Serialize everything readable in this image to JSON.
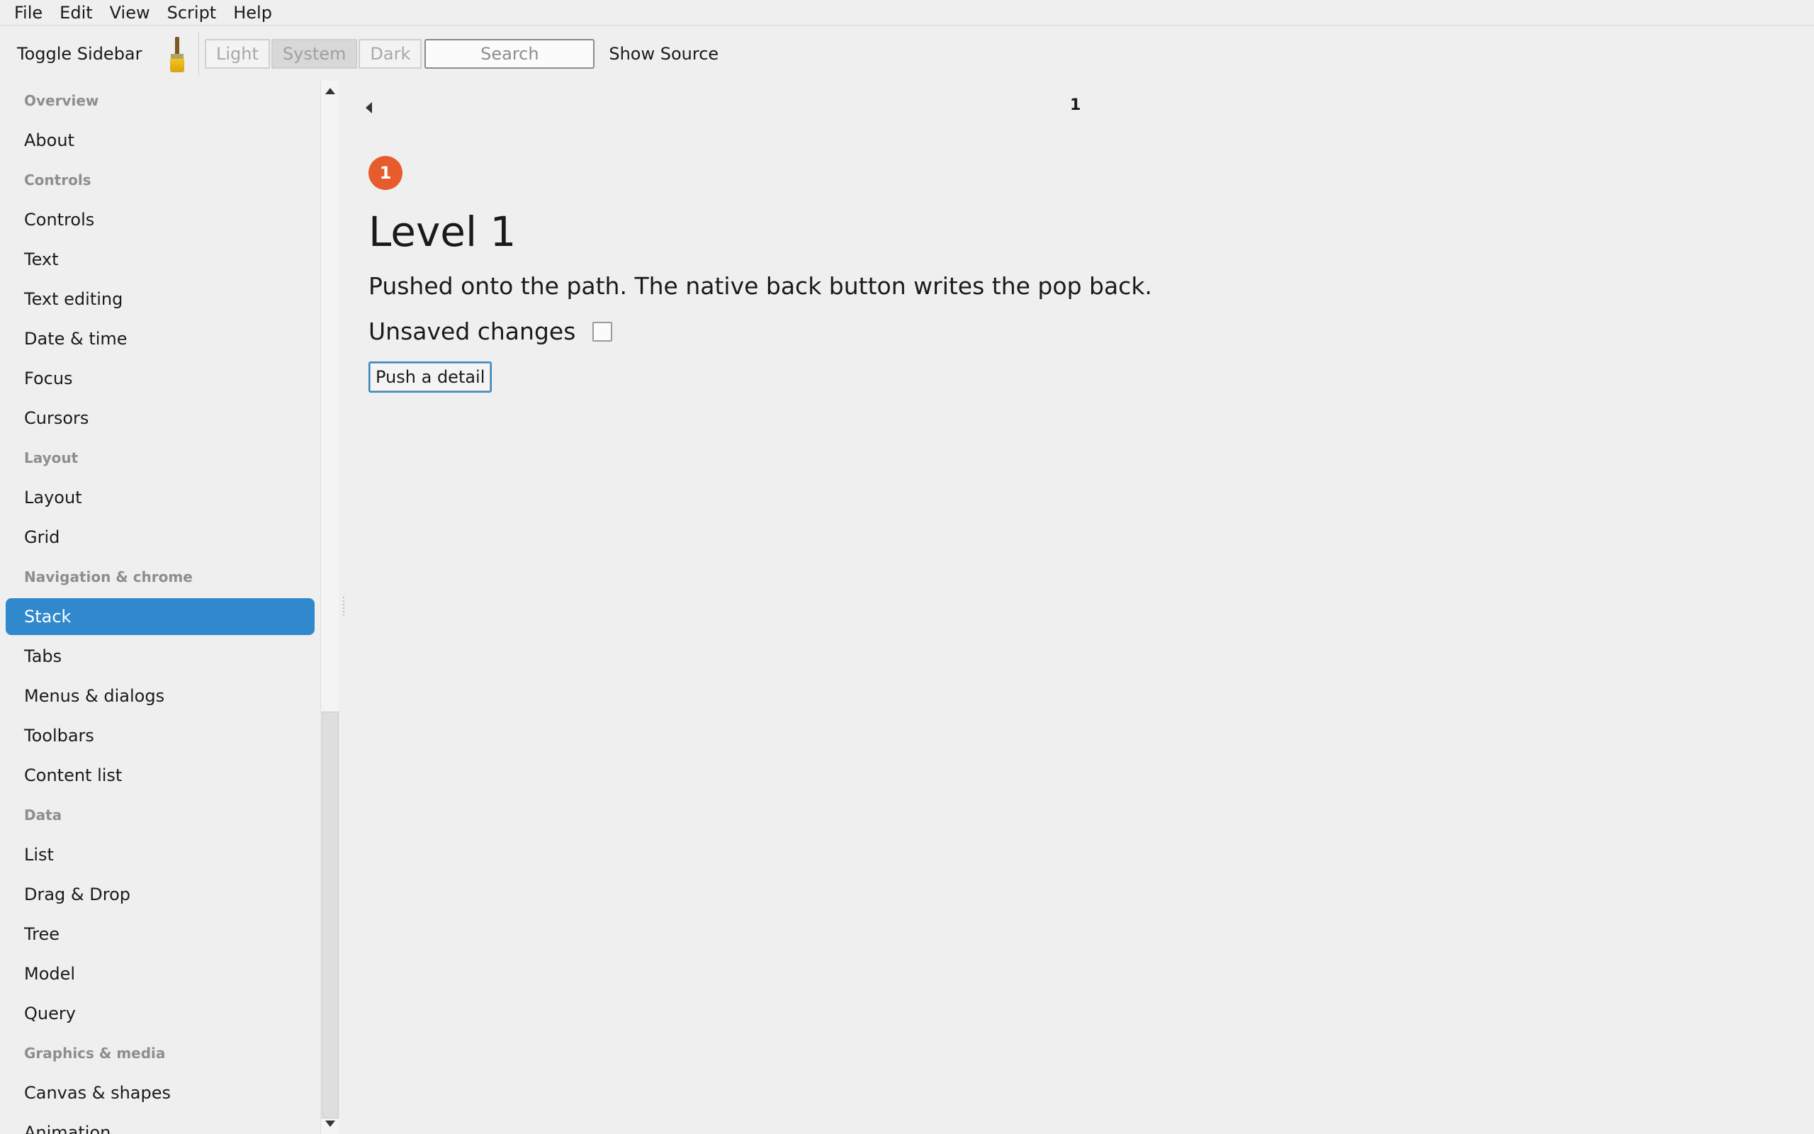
{
  "menubar": {
    "items": [
      "File",
      "Edit",
      "View",
      "Script",
      "Help"
    ]
  },
  "toolbar": {
    "toggle_sidebar": "Toggle Sidebar",
    "theme_options": [
      "Light",
      "System",
      "Dark"
    ],
    "active_theme": "System",
    "search_placeholder": "Search",
    "show_source": "Show Source"
  },
  "sidebar": {
    "selected": "Stack",
    "sections": [
      {
        "title": "Overview",
        "items": [
          "About"
        ]
      },
      {
        "title": "Controls",
        "items": [
          "Controls",
          "Text",
          "Text editing",
          "Date & time",
          "Focus",
          "Cursors"
        ]
      },
      {
        "title": "Layout",
        "items": [
          "Layout",
          "Grid"
        ]
      },
      {
        "title": "Navigation & chrome",
        "items": [
          "Stack",
          "Tabs",
          "Menus & dialogs",
          "Toolbars",
          "Content list"
        ]
      },
      {
        "title": "Data",
        "items": [
          "List",
          "Drag & Drop",
          "Tree",
          "Model",
          "Query"
        ]
      },
      {
        "title": "Graphics & media",
        "items": [
          "Canvas & shapes",
          "Animation"
        ]
      }
    ]
  },
  "content": {
    "nav_title": "1",
    "badge": "1",
    "title": "Level 1",
    "description": "Pushed onto the path. The native back button writes the pop back.",
    "unsaved_label": "Unsaved changes",
    "push_button": "Push a detail"
  },
  "colors": {
    "accent": "#2f89cc",
    "badge": "#e65c2c",
    "background": "#efefef"
  }
}
